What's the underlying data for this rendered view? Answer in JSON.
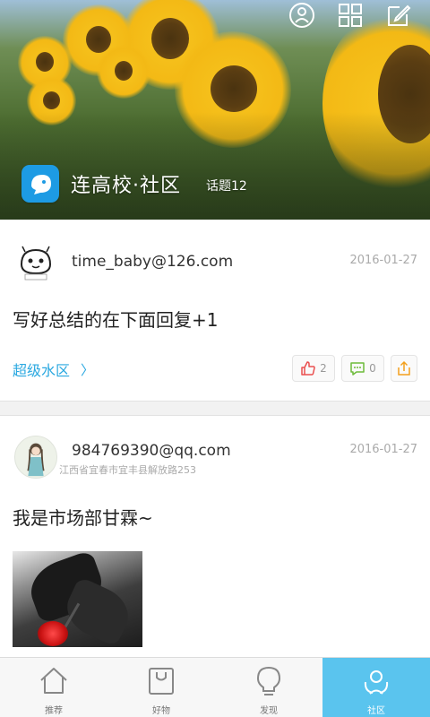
{
  "header": {
    "brand_name": "连高校·社区",
    "topic_count": "话题12",
    "icons": [
      "profile-icon",
      "grid-icon",
      "compose-icon"
    ]
  },
  "posts": [
    {
      "user": "time_baby@126.com",
      "date": "2016-01-27",
      "text": "写好总结的在下面回复+1",
      "board": "超级水区",
      "likes": "2",
      "comments": "0"
    },
    {
      "user": "984769390@qq.com",
      "location": "江西省宜春市宜丰县解放路253",
      "date": "2016-01-27",
      "text": "我是市场部甘霖~"
    }
  ],
  "nav": {
    "items": [
      {
        "label": "推荐",
        "icon": "home-icon"
      },
      {
        "label": "好物",
        "icon": "shopping-bag-icon"
      },
      {
        "label": "发现",
        "icon": "lightbulb-icon"
      },
      {
        "label": "社区",
        "icon": "community-icon",
        "active": true
      }
    ]
  },
  "colors": {
    "accent": "#2aa8e0",
    "nav_active": "#5ac4ee",
    "logo": "#1d9be4"
  }
}
